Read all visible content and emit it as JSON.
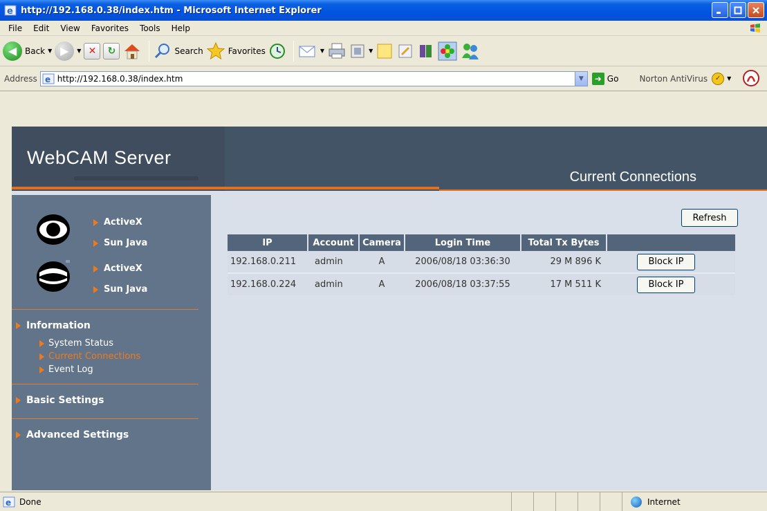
{
  "window": {
    "title": "http://192.168.0.38/index.htm - Microsoft Internet Explorer"
  },
  "menu": [
    {
      "label": "File",
      "accel": "F"
    },
    {
      "label": "Edit",
      "accel": "E"
    },
    {
      "label": "View",
      "accel": "V"
    },
    {
      "label": "Favorites",
      "accel": "a"
    },
    {
      "label": "Tools",
      "accel": "T"
    },
    {
      "label": "Help",
      "accel": "H"
    }
  ],
  "toolbar": {
    "back_label": "Back",
    "search_label": "Search",
    "favorites_label": "Favorites"
  },
  "address": {
    "label": "Address",
    "url": "http://192.168.0.38/index.htm",
    "go_label": "Go",
    "norton_label": "Norton AntiVirus"
  },
  "banner": {
    "brand": "WebCAM Server",
    "page_title": "Current Connections"
  },
  "sidebar": {
    "camera1": {
      "activex": "ActiveX",
      "java": "Sun Java"
    },
    "camera2": {
      "activex": "ActiveX",
      "java": "Sun Java"
    },
    "information": {
      "label": "Information",
      "items": [
        "System Status",
        "Current Connections",
        "Event Log"
      ]
    },
    "basic_settings": "Basic Settings",
    "advanced_settings": "Advanced Settings"
  },
  "connections": {
    "refresh_label": "Refresh",
    "columns": [
      "IP",
      "Account",
      "Camera",
      "Login Time",
      "Total Tx Bytes"
    ],
    "block_label": "Block IP",
    "rows": [
      {
        "ip": "192.168.0.211",
        "account": "admin",
        "camera": "A",
        "login_time": "2006/08/18 03:36:30",
        "tx": "29 M 896 K"
      },
      {
        "ip": "192.168.0.224",
        "account": "admin",
        "camera": "A",
        "login_time": "2006/08/18 03:37:55",
        "tx": "17 M 511 K"
      }
    ]
  },
  "status": {
    "left": "Done",
    "zone": "Internet"
  },
  "colors": {
    "banner_dark": "#3f4d5e",
    "sidebar": "#627489",
    "accent_orange": "#e2701e",
    "content_bg": "#d9e0ea"
  }
}
